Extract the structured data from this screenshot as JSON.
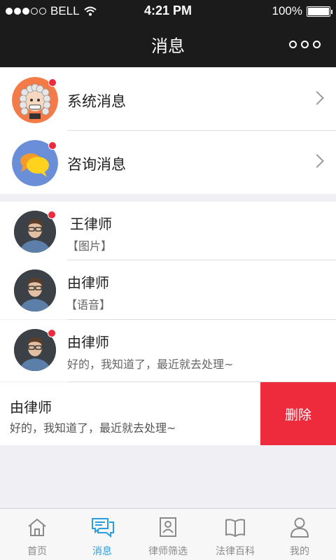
{
  "status_bar": {
    "carrier": "BELL",
    "time": "4:21 PM",
    "battery": "100%"
  },
  "nav": {
    "title": "消息"
  },
  "system_list": [
    {
      "label": "系统消息",
      "icon": "judge-icon",
      "unread": true
    },
    {
      "label": "咨询消息",
      "icon": "chat-bubbles-icon",
      "unread": true
    }
  ],
  "chats": [
    {
      "name": "王律师",
      "message": "【图片】",
      "unread": true
    },
    {
      "name": "由律师",
      "message": "【语音】",
      "unread": false
    },
    {
      "name": "由律师",
      "message": "好的，我知道了，最近就去处理~",
      "unread": true
    }
  ],
  "swiped_chat": {
    "name": "由律师",
    "message": "好的，我知道了，最近就去处理~",
    "delete_label": "删除"
  },
  "tabs": [
    {
      "label": "首页",
      "icon": "home-icon",
      "active": false
    },
    {
      "label": "消息",
      "icon": "message-icon",
      "active": true
    },
    {
      "label": "律师筛选",
      "icon": "lawyer-filter-icon",
      "active": false
    },
    {
      "label": "法律百科",
      "icon": "book-icon",
      "active": false
    },
    {
      "label": "我的",
      "icon": "person-icon",
      "active": false
    }
  ],
  "colors": {
    "accent": "#2a9fe0",
    "danger": "#ee2b3c",
    "navbar": "#1b1b1b"
  }
}
